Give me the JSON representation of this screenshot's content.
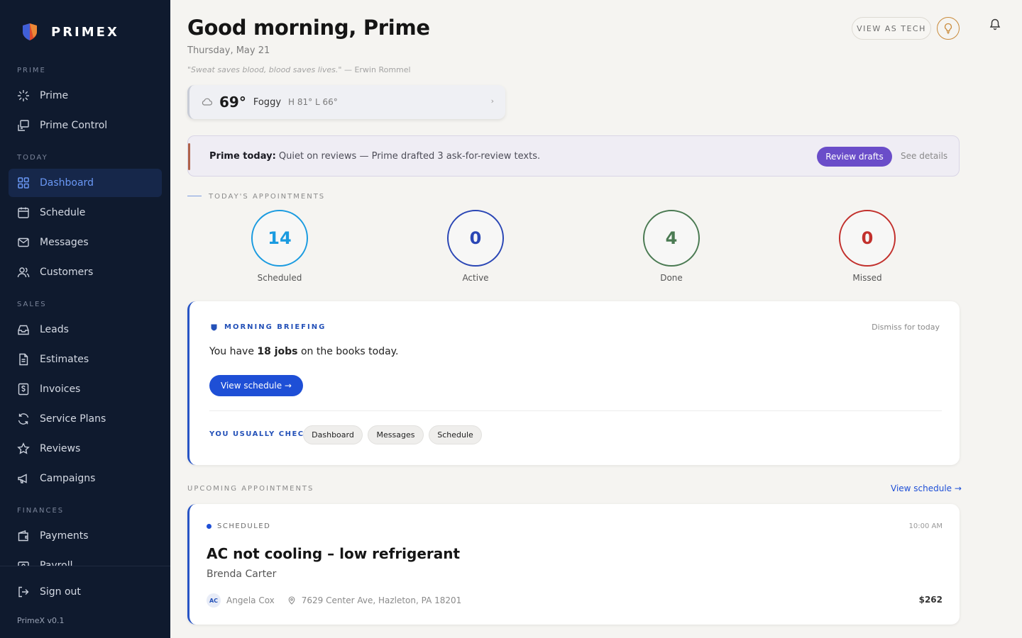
{
  "brand": {
    "name": "PRIMEX"
  },
  "sidebar": {
    "sections": [
      {
        "label": "PRIME",
        "items": [
          {
            "label": "Prime",
            "icon": "sparkle-icon"
          },
          {
            "label": "Prime Control",
            "icon": "control-icon"
          }
        ]
      },
      {
        "label": "TODAY",
        "items": [
          {
            "label": "Dashboard",
            "icon": "grid-icon",
            "active": true
          },
          {
            "label": "Schedule",
            "icon": "calendar-icon"
          },
          {
            "label": "Messages",
            "icon": "mail-icon"
          },
          {
            "label": "Customers",
            "icon": "users-icon"
          }
        ]
      },
      {
        "label": "SALES",
        "items": [
          {
            "label": "Leads",
            "icon": "inbox-icon"
          },
          {
            "label": "Estimates",
            "icon": "document-icon"
          },
          {
            "label": "Invoices",
            "icon": "dollar-icon"
          },
          {
            "label": "Service Plans",
            "icon": "refresh-icon"
          },
          {
            "label": "Reviews",
            "icon": "star-icon"
          },
          {
            "label": "Campaigns",
            "icon": "megaphone-icon"
          }
        ]
      },
      {
        "label": "FINANCES",
        "items": [
          {
            "label": "Payments",
            "icon": "wallet-icon"
          },
          {
            "label": "Payroll",
            "icon": "payroll-icon"
          }
        ]
      }
    ],
    "sign_out": "Sign out",
    "version": "PrimeX v0.1"
  },
  "header": {
    "greeting": "Good morning, Prime",
    "date": "Thursday, May 21",
    "quote_text": "\"Sweat saves blood, blood saves lives.\"",
    "quote_author": " — Erwin Rommel",
    "view_as_tech": "VIEW AS TECH"
  },
  "weather": {
    "temp": "69°",
    "condition": "Foggy",
    "high_low": "H 81° L 66°",
    "chevron": "›"
  },
  "prime_today": {
    "label": "Prime today:",
    "text": " Quiet on reviews — Prime drafted 3 ask-for-review texts.",
    "review_button": "Review drafts",
    "see_details": "See details"
  },
  "appointments_today": {
    "label": "TODAY'S APPOINTMENTS",
    "stats": [
      {
        "value": "14",
        "label": "Scheduled",
        "color": "#1a9be0"
      },
      {
        "value": "0",
        "label": "Active",
        "color": "#2a46b5"
      },
      {
        "value": "4",
        "label": "Done",
        "color": "#4a7a52"
      },
      {
        "value": "0",
        "label": "Missed",
        "color": "#c2302c"
      }
    ]
  },
  "briefing": {
    "label": "MORNING BRIEFING",
    "dismiss": "Dismiss for today",
    "msg_pre": "You have ",
    "msg_bold": "18 jobs",
    "msg_post": " on the books today.",
    "button": "View schedule →",
    "usually_label": "YOU USUALLY CHECK",
    "chips": [
      "Dashboard",
      "Messages",
      "Schedule"
    ]
  },
  "upcoming": {
    "label": "UPCOMING APPOINTMENTS",
    "link": "View schedule →",
    "appointment": {
      "status": "SCHEDULED",
      "time": "10:00 AM",
      "title": "AC not cooling – low refrigerant",
      "customer": "Brenda Carter",
      "tech_initials": "AC",
      "tech_name": "Angela Cox",
      "address": "7629 Center Ave, Hazleton, PA 18201",
      "price": "$262"
    }
  }
}
